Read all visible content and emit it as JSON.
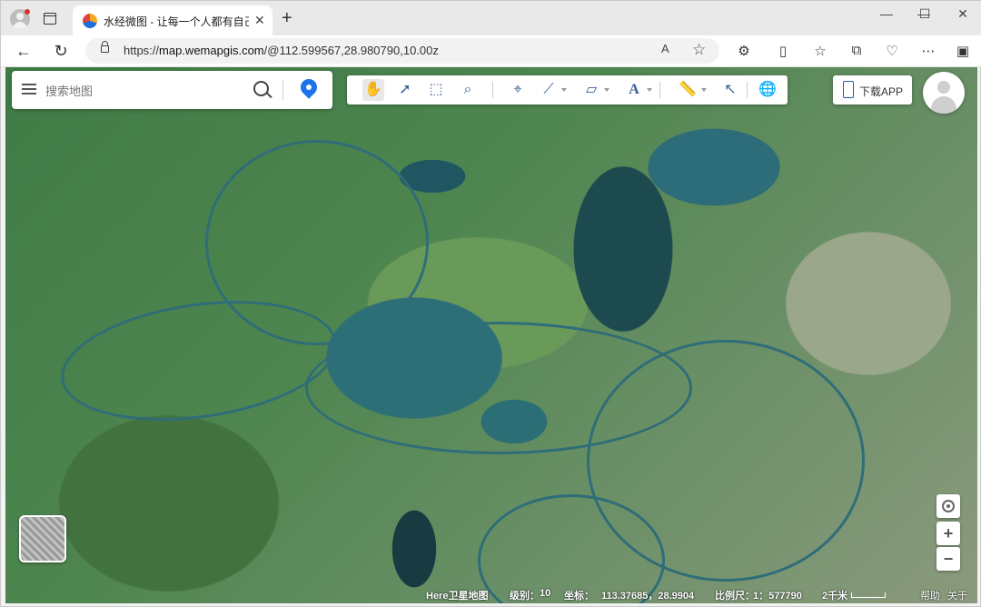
{
  "browser": {
    "tab_title": "水经微图 - 让每一个人都有自己的",
    "tab_close": "✕",
    "new_tab": "+",
    "url_host": "map.wemapgis.com",
    "url_prefix": "https://",
    "url_path": "/@112.599567,28.980790,10.00z",
    "read_aloud": "A",
    "favorite": "☆",
    "minimize": "—",
    "maximize": "☐",
    "close": "✕",
    "back": "←",
    "reload": "↻"
  },
  "search": {
    "placeholder": "搜索地图"
  },
  "toolbar": {
    "text_tool": "A"
  },
  "app_button": {
    "label": "下载APP"
  },
  "zoom": {
    "plus": "+",
    "minus": "−"
  },
  "status": {
    "source": "Here卫星地图",
    "level_label": "级别：",
    "level_value": "10",
    "coord_label": "坐标：",
    "coord_value": "113.37685，28.9904",
    "scale_label": "比例尺：",
    "scale_value": "1：577790",
    "scale_bar": "2千米",
    "help": "帮助",
    "about": "关于"
  }
}
